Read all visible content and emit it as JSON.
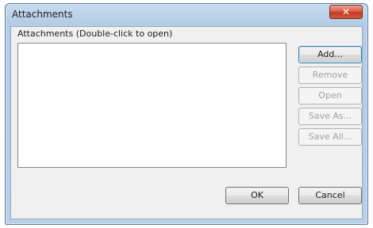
{
  "window": {
    "title": "Attachments",
    "close_glyph": "✕"
  },
  "attachments": {
    "label": "Attachments (Double-click to open)",
    "items": []
  },
  "buttons": {
    "add": "Add...",
    "remove": "Remove",
    "open": "Open",
    "save_as": "Save As...",
    "save_all": "Save All...",
    "ok": "OK",
    "cancel": "Cancel"
  },
  "states": {
    "add_enabled": true,
    "remove_enabled": false,
    "open_enabled": false,
    "save_as_enabled": false,
    "save_all_enabled": false,
    "ok_enabled": true,
    "cancel_enabled": true
  },
  "colors": {
    "titlebar": "#c9dcef",
    "client_background": "#f0f0f0",
    "close_button": "#c23a20",
    "disabled_text": "#a0a0a0"
  },
  "icons": {
    "close": "close-icon"
  }
}
